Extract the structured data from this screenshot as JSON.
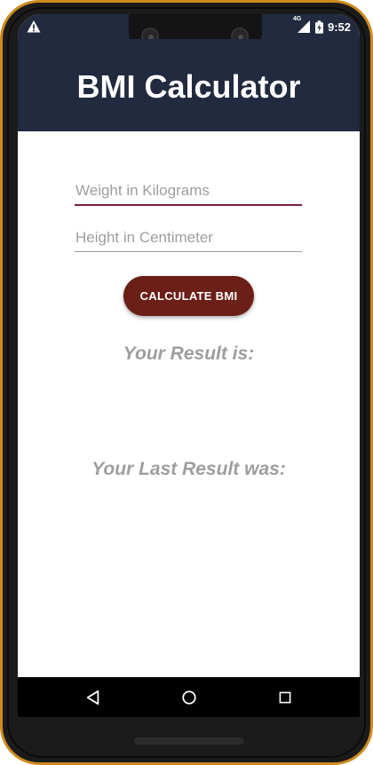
{
  "status_bar": {
    "network": "4G",
    "time": "9:52",
    "warning_icon": "warning-icon",
    "signal_icon": "signal-icon",
    "battery_icon": "battery-charging-icon"
  },
  "app_bar": {
    "title": "BMI Calculator"
  },
  "form": {
    "weight_placeholder": "Weight in Kilograms",
    "height_placeholder": "Height in Centimeter",
    "calculate_label": "CALCULATE BMI"
  },
  "results": {
    "current_label": "Your Result is:",
    "last_label": "Your Last Result was:"
  },
  "nav_bar": {
    "back_icon": "back-triangle-icon",
    "home_icon": "home-circle-icon",
    "recents_icon": "recents-square-icon"
  },
  "colors": {
    "app_bar": "#212a3e",
    "button": "#6b1f17",
    "accent_underline": "#7a1f3a",
    "result_text": "#9e9e9e",
    "device_trim": "#cf8a1e"
  }
}
